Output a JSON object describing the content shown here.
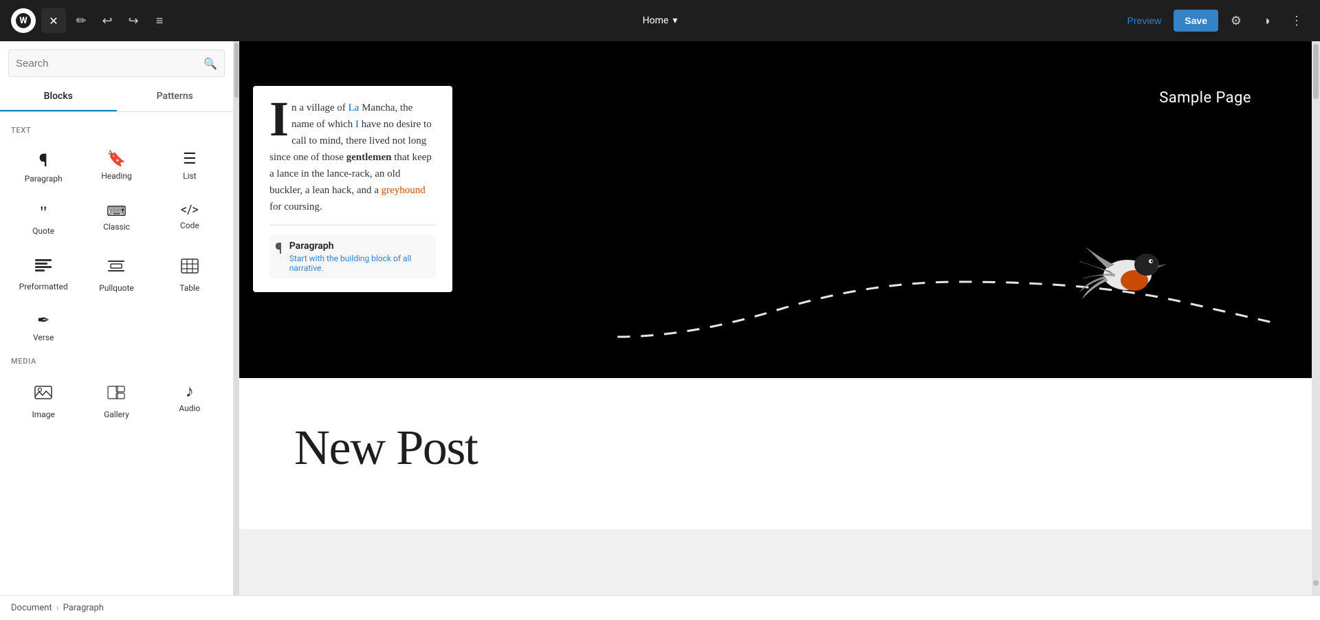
{
  "toolbar": {
    "page_title": "Home",
    "preview_label": "Preview",
    "save_label": "Save",
    "undo_icon": "↩",
    "redo_icon": "↪",
    "menu_icon": "≡",
    "pencil_icon": "✎",
    "close_icon": "✕",
    "settings_icon": "⚙",
    "contrast_icon": "◑",
    "more_icon": "⋮"
  },
  "sidebar": {
    "search_placeholder": "Search",
    "tabs": [
      {
        "label": "Blocks",
        "active": true
      },
      {
        "label": "Patterns",
        "active": false
      }
    ],
    "sections": [
      {
        "label": "TEXT",
        "blocks": [
          {
            "icon": "¶",
            "label": "Paragraph"
          },
          {
            "icon": "🔖",
            "label": "Heading"
          },
          {
            "icon": "☰",
            "label": "List"
          },
          {
            "icon": "❝",
            "label": "Quote"
          },
          {
            "icon": "⌨",
            "label": "Classic"
          },
          {
            "icon": "〈〉",
            "label": "Code"
          },
          {
            "icon": "▤",
            "label": "Preformatted"
          },
          {
            "icon": "▬",
            "label": "Pullquote"
          },
          {
            "icon": "▦",
            "label": "Table"
          },
          {
            "icon": "✒",
            "label": "Verse"
          }
        ]
      },
      {
        "label": "MEDIA",
        "blocks": [
          {
            "icon": "▱",
            "label": "Image"
          },
          {
            "icon": "▭",
            "label": "Gallery"
          },
          {
            "icon": "♪",
            "label": "Audio"
          }
        ]
      }
    ]
  },
  "canvas": {
    "hero_title": "Sample Page",
    "popup": {
      "text_part1": "n a village of La Mancha, the name of which I have no desire to call to mind, there lived not long since one of those gentlemen that keep a lance in the lance-rack, an old buckler, a lean hack, and a greyhound for coursing.",
      "hint_title": "Paragraph",
      "hint_desc": "Start with the building block of all narrative."
    },
    "new_post_title": "New Post"
  },
  "breadcrumb": {
    "items": [
      {
        "label": "Document"
      },
      {
        "label": "Paragraph"
      }
    ]
  }
}
